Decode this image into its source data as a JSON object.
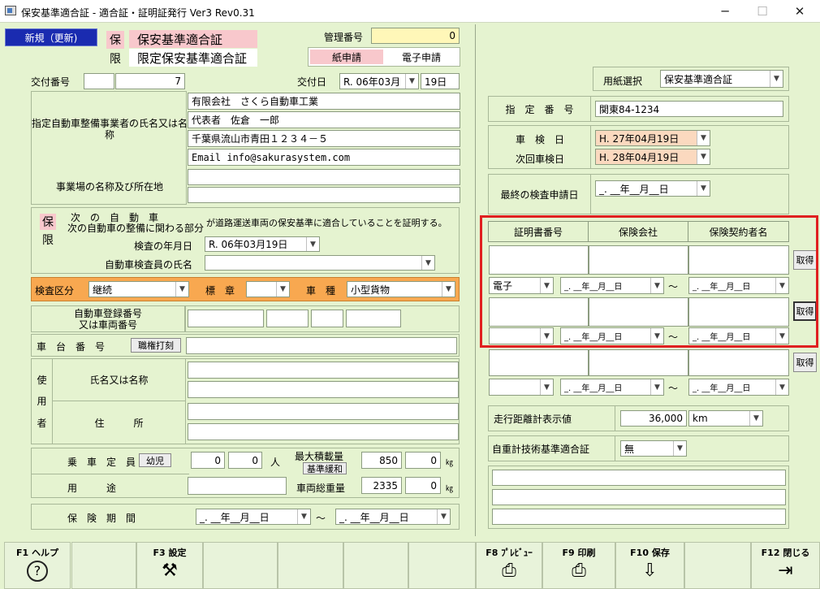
{
  "window": {
    "title": "保安基準適合証 - 適合証・証明証発行 Ver3 Rev0.31",
    "minimize": "─",
    "maximize": "☐",
    "close": "✕"
  },
  "header": {
    "new_badge": "新規（更新)",
    "ho_char": "保",
    "gen_char": "限",
    "cert1": "保安基準適合証",
    "cert2": "限定保安基準適合証",
    "kanri_label": "管理番号",
    "kanri_value": "0",
    "paper_tab": "紙申請",
    "electronic_tab": "電子申請"
  },
  "issue": {
    "kofu_label": "交付番号",
    "kofu_num": "7",
    "kofu_date_label": "交付日",
    "kofu_date_month": "R. 06年03月",
    "kofu_date_day": "19日"
  },
  "shop": {
    "designated_label": "指定自動車整備事業者の氏名又は名称",
    "line1": "有限会社　さくら自動車工業",
    "line2": "代表者　佐倉　一郎",
    "line3": "千葉県流山市青田１２３４－５",
    "line4": "Email info@sakurasystem.com",
    "location_label": "事業場の名称及び所在地"
  },
  "cert_statement": {
    "ho": "保",
    "gen": "限",
    "next_line": "次　の　自　動　車",
    "next_line2": "次の自動車の整備に関わる部分",
    "statement": "が道路運送車両の保安基準に適合していることを証明する。",
    "inspect_date_label": "検査の年月日",
    "inspect_date": "R. 06年03月19日",
    "inspector_label": "自動車検査員の氏名"
  },
  "inspection": {
    "kubun_label": "検査区分",
    "kubun_value": "継続",
    "hyosho_label": "標　章",
    "shashu_label": "車　種",
    "shashu_value": "小型貨物"
  },
  "vehicle": {
    "reg_label1": "自動車登録番号",
    "reg_label2": "又は車両番号",
    "chassis_label": "車　台　番　号",
    "chassis_btn": "職権打刻",
    "user_label": "使用者",
    "user_chars": [
      "使",
      "用",
      "者"
    ],
    "name_label": "氏名又は名称",
    "address_label": "住　　　所"
  },
  "capacity": {
    "jousha_label": "乗　車　定　員",
    "youji_btn": "幼児",
    "jousha_a": "0",
    "jousha_b": "0",
    "nin": "人",
    "max_load_label": "最大積載量",
    "kijun_btn": "基準緩和",
    "max_load_a": "850",
    "max_load_b": "0",
    "kg": "㎏",
    "youto_label": "用　　　途",
    "total_weight_label": "車両総重量",
    "total_a": "2335",
    "total_b": "0"
  },
  "insurance_period": {
    "label": "保　険　期　間",
    "from": "_. __年__月__日",
    "tilde": "〜",
    "to": "_. __年__月__日"
  },
  "right": {
    "paper_label": "用紙選択",
    "paper_value": "保安基準適合証",
    "shitei_label": "指　定　番　号",
    "shitei_value": "関東84-1234",
    "shaken_label": "車　検　日",
    "shaken_value": "H. 27年04月19日",
    "next_label": "次回車検日",
    "next_value": "H. 28年04月19日",
    "last_label": "最終の検査申請日",
    "last_value": "_. __年__月__日"
  },
  "insurance_table": {
    "headers": [
      "証明書番号",
      "保険会社",
      "保険契約者名"
    ],
    "get_btn": "取得",
    "rows": [
      {
        "type": "電子",
        "from": "_. __年__月__日",
        "to": "_. __年__月__日"
      },
      {
        "type": "",
        "from": "_. __年__月__日",
        "to": "_. __年__月__日"
      },
      {
        "type": "",
        "from": "_. __年__月__日",
        "to": "_. __年__月__日"
      }
    ],
    "tilde": "〜"
  },
  "meter": {
    "label": "走行距離計表示値",
    "value": "36,000",
    "unit": "km",
    "jiju_label": "自重計技術基準適合証",
    "jiju_value": "無"
  },
  "fkeys": [
    {
      "label": "F1 ヘルプ",
      "icon": "?"
    },
    {
      "label": "",
      "icon": ""
    },
    {
      "label": "F3 設定",
      "icon": "⚒"
    },
    {
      "label": "",
      "icon": ""
    },
    {
      "label": "",
      "icon": ""
    },
    {
      "label": "",
      "icon": ""
    },
    {
      "label": "",
      "icon": ""
    },
    {
      "label": "F8 ﾌﾟﾚﾋﾞｭｰ",
      "icon": "⎙"
    },
    {
      "label": "F9 印刷",
      "icon": "⎙"
    },
    {
      "label": "F10 保存",
      "icon": "⇩"
    },
    {
      "label": "",
      "icon": ""
    },
    {
      "label": "F12 閉じる",
      "icon": "⇥"
    }
  ],
  "colors": {
    "pink": "#f8c8cc",
    "yellow": "#fff7b8",
    "orange": "#f8a850",
    "peach": "#fbd9bf",
    "navy": "#1a2bb0",
    "red": "#e02020"
  }
}
